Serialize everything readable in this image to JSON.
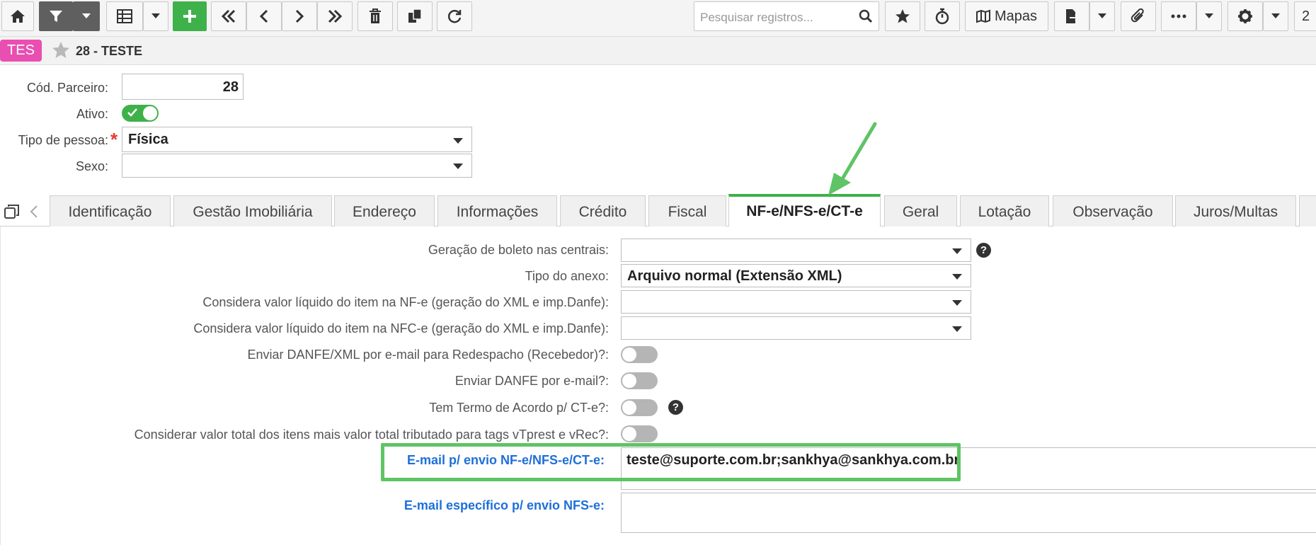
{
  "toolbar": {
    "search_placeholder": "Pesquisar registros...",
    "mapas_label": "Mapas",
    "page_fragment": "2",
    "accent_green": "#3fb14a"
  },
  "record": {
    "badge": "TES",
    "title": "28 - TESTE",
    "badge_color": "#e94fb0"
  },
  "header_form": {
    "cod_parceiro_label": "Cód. Parceiro:",
    "cod_parceiro_value": "28",
    "ativo_label": "Ativo:",
    "ativo_on": true,
    "tipo_pessoa_label": "Tipo de pessoa:",
    "tipo_pessoa_required": "*",
    "tipo_pessoa_value": "Física",
    "sexo_label": "Sexo:",
    "sexo_value": ""
  },
  "tabs": [
    {
      "label": "Identificação"
    },
    {
      "label": "Gestão Imobiliária"
    },
    {
      "label": "Endereço"
    },
    {
      "label": "Informações"
    },
    {
      "label": "Crédito"
    },
    {
      "label": "Fiscal"
    },
    {
      "label": "NF-e/NFS-e/CT-e"
    },
    {
      "label": "Geral"
    },
    {
      "label": "Lotação"
    },
    {
      "label": "Observação"
    },
    {
      "label": "Juros/Multas"
    }
  ],
  "active_tab": "NF-e/NFS-e/CT-e",
  "fields": {
    "geracao_boleto_label": "Geração de boleto nas centrais:",
    "geracao_boleto_value": "",
    "tipo_anexo_label": "Tipo do anexo:",
    "tipo_anexo_value": "Arquivo normal (Extensão XML)",
    "valor_liquido_nfe_label": "Considera valor líquido do item na NF-e (geração do XML e imp.Danfe):",
    "valor_liquido_nfe_value": "",
    "valor_liquido_nfce_label": "Considera valor líquido do item na NFC-e (geração do XML e imp.Danfe):",
    "valor_liquido_nfce_value": "",
    "enviar_redespacho_label": "Enviar DANFE/XML por e-mail para Redespacho (Recebedor)?:",
    "enviar_redespacho_on": false,
    "enviar_danfe_label": "Enviar DANFE por e-mail?:",
    "enviar_danfe_on": false,
    "termo_acordo_label": "Tem Termo de Acordo p/ CT-e?:",
    "termo_acordo_on": false,
    "valor_total_label": "Considerar valor total dos itens mais valor total tributado para tags vTprest e vRec?:",
    "valor_total_on": false,
    "email_envio_label": "E-mail p/ envio NF-e/NFS-e/CT-e:",
    "email_envio_value": "teste@suporte.com.br;sankhya@sankhya.com.br",
    "email_nfse_label": "E-mail específico p/ envio NFS-e:",
    "email_nfse_value": "",
    "help_mark": "?"
  }
}
